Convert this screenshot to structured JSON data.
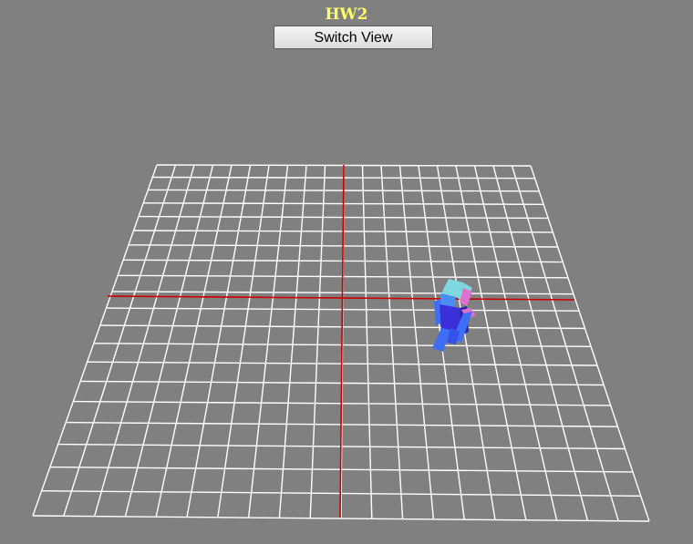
{
  "header": {
    "title": "HW2"
  },
  "controls": {
    "switch_view_label": "Switch View"
  },
  "scene": {
    "background_color": "#808080",
    "title_color": "#ffff66",
    "grid_color": "#ffffff",
    "axis_color": "#cc0000",
    "grid_divisions": 20,
    "figure_colors": {
      "head_top": "#7fd8e0",
      "head_side": "#4a8cf0",
      "body": "#3a2fd8",
      "limb": "#3d6ef5",
      "accent": "#e070d0"
    }
  }
}
